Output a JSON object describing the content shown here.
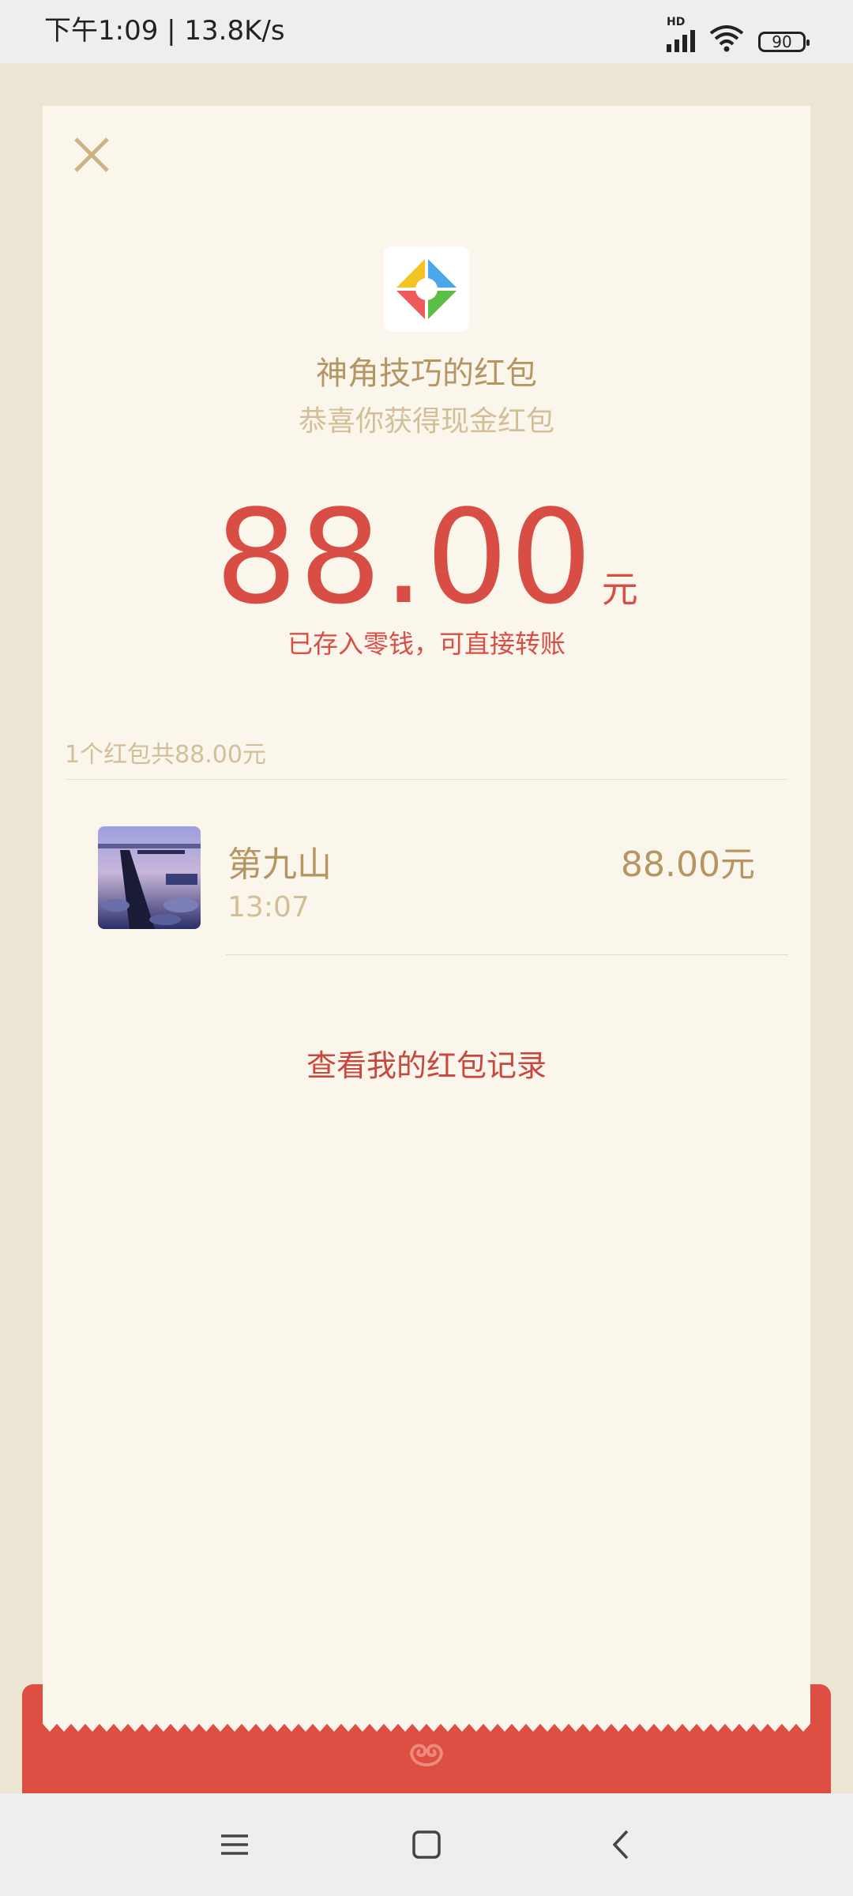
{
  "status_bar": {
    "time_speed": "下午1:09 | 13.8K/s",
    "hd_label": "HD",
    "battery": "90"
  },
  "packet": {
    "sender_title": "神角技巧的红包",
    "subtitle": "恭喜你获得现金红包",
    "amount": "88.00",
    "unit": "元",
    "deposit_note": "已存入零钱，可直接转账",
    "summary": "1个红包共88.00元",
    "history_link": "查看我的红包记录"
  },
  "records": [
    {
      "name": "第九山",
      "time": "13:07",
      "amount": "88.00元"
    }
  ],
  "colors": {
    "accent_red": "#d84d44",
    "gold_text": "#b59663",
    "light_gold": "#d2bf98",
    "card_bg": "#faf6ec",
    "page_bg": "#ede5d3"
  },
  "icons": {
    "close": "close-icon",
    "logo": "app-logo-icon",
    "menu": "menu-icon",
    "home": "home-icon",
    "back": "back-icon"
  }
}
